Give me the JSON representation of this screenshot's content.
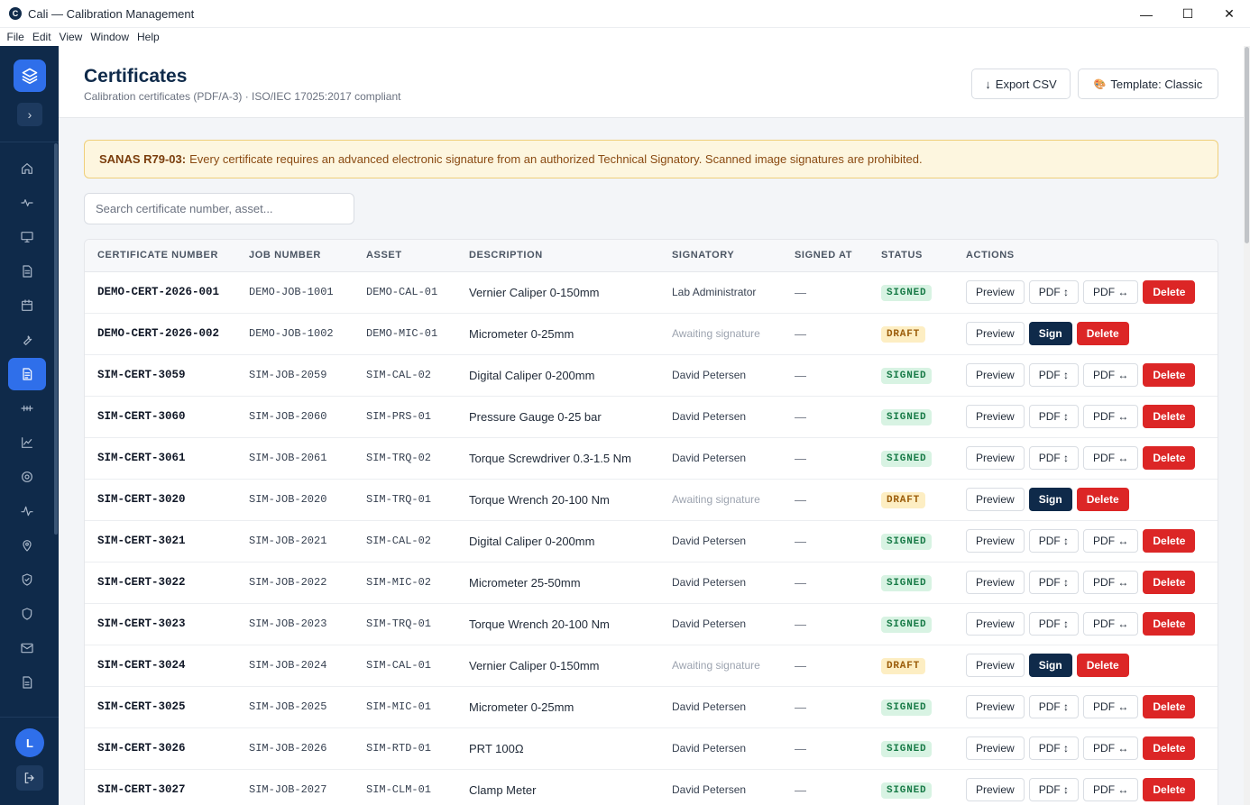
{
  "window": {
    "app_icon_letter": "C",
    "title": "Cali — Calibration Management",
    "controls": {
      "minimize": "—",
      "maximize": "☐",
      "close": "✕"
    }
  },
  "menu": [
    "File",
    "Edit",
    "View",
    "Window",
    "Help"
  ],
  "sidebar": {
    "collapse_glyph": "›",
    "nav": [
      {
        "icon": "home-icon",
        "active": false
      },
      {
        "icon": "activity-icon",
        "active": false
      },
      {
        "icon": "monitor-icon",
        "active": false
      },
      {
        "icon": "document-icon",
        "active": false
      },
      {
        "icon": "calendar-icon",
        "active": false
      },
      {
        "icon": "wrench-icon",
        "active": false
      },
      {
        "icon": "certificate-icon",
        "active": true
      },
      {
        "icon": "sliders-icon",
        "active": false
      },
      {
        "icon": "line-chart-icon",
        "active": false
      },
      {
        "icon": "target-icon",
        "active": false
      },
      {
        "icon": "pulse-icon",
        "active": false
      },
      {
        "icon": "map-pin-icon",
        "active": false
      },
      {
        "icon": "shield-check-icon",
        "active": false
      },
      {
        "icon": "shield-icon",
        "active": false
      },
      {
        "icon": "mail-icon",
        "active": false
      },
      {
        "icon": "file-list-icon",
        "active": false
      }
    ],
    "avatar_letter": "L"
  },
  "header": {
    "title": "Certificates",
    "subtitle": "Calibration certificates (PDF/A-3) · ISO/IEC 17025:2017 compliant",
    "export_label": "Export CSV",
    "export_glyph": "↓",
    "template_label": "Template: Classic",
    "template_glyph": "🎨"
  },
  "notice": {
    "code": "SANAS R79-03:",
    "text": "Every certificate requires an advanced electronic signature from an authorized Technical Signatory. Scanned image signatures are prohibited."
  },
  "search": {
    "placeholder": "Search certificate number, asset...",
    "value": ""
  },
  "table": {
    "columns": [
      "CERTIFICATE NUMBER",
      "JOB NUMBER",
      "ASSET",
      "DESCRIPTION",
      "SIGNATORY",
      "SIGNED AT",
      "STATUS",
      "ACTIONS"
    ],
    "action_labels": {
      "preview": "Preview",
      "pdf_portrait": "PDF ↕",
      "pdf_landscape": "PDF ↔",
      "sign": "Sign",
      "delete": "Delete"
    },
    "rows": [
      {
        "cert": "DEMO-CERT-2026-001",
        "job": "DEMO-JOB-1001",
        "asset": "DEMO-CAL-01",
        "desc": "Vernier Caliper 0-150mm",
        "signatory": "Lab Administrator",
        "signed_at": "—",
        "status": "SIGNED"
      },
      {
        "cert": "DEMO-CERT-2026-002",
        "job": "DEMO-JOB-1002",
        "asset": "DEMO-MIC-01",
        "desc": "Micrometer 0-25mm",
        "signatory": "Awaiting signature",
        "signed_at": "—",
        "status": "DRAFT"
      },
      {
        "cert": "SIM-CERT-3059",
        "job": "SIM-JOB-2059",
        "asset": "SIM-CAL-02",
        "desc": "Digital Caliper 0-200mm",
        "signatory": "David Petersen",
        "signed_at": "—",
        "status": "SIGNED"
      },
      {
        "cert": "SIM-CERT-3060",
        "job": "SIM-JOB-2060",
        "asset": "SIM-PRS-01",
        "desc": "Pressure Gauge 0-25 bar",
        "signatory": "David Petersen",
        "signed_at": "—",
        "status": "SIGNED"
      },
      {
        "cert": "SIM-CERT-3061",
        "job": "SIM-JOB-2061",
        "asset": "SIM-TRQ-02",
        "desc": "Torque Screwdriver 0.3-1.5 Nm",
        "signatory": "David Petersen",
        "signed_at": "—",
        "status": "SIGNED"
      },
      {
        "cert": "SIM-CERT-3020",
        "job": "SIM-JOB-2020",
        "asset": "SIM-TRQ-01",
        "desc": "Torque Wrench 20-100 Nm",
        "signatory": "Awaiting signature",
        "signed_at": "—",
        "status": "DRAFT"
      },
      {
        "cert": "SIM-CERT-3021",
        "job": "SIM-JOB-2021",
        "asset": "SIM-CAL-02",
        "desc": "Digital Caliper 0-200mm",
        "signatory": "David Petersen",
        "signed_at": "—",
        "status": "SIGNED"
      },
      {
        "cert": "SIM-CERT-3022",
        "job": "SIM-JOB-2022",
        "asset": "SIM-MIC-02",
        "desc": "Micrometer 25-50mm",
        "signatory": "David Petersen",
        "signed_at": "—",
        "status": "SIGNED"
      },
      {
        "cert": "SIM-CERT-3023",
        "job": "SIM-JOB-2023",
        "asset": "SIM-TRQ-01",
        "desc": "Torque Wrench 20-100 Nm",
        "signatory": "David Petersen",
        "signed_at": "—",
        "status": "SIGNED"
      },
      {
        "cert": "SIM-CERT-3024",
        "job": "SIM-JOB-2024",
        "asset": "SIM-CAL-01",
        "desc": "Vernier Caliper 0-150mm",
        "signatory": "Awaiting signature",
        "signed_at": "—",
        "status": "DRAFT"
      },
      {
        "cert": "SIM-CERT-3025",
        "job": "SIM-JOB-2025",
        "asset": "SIM-MIC-01",
        "desc": "Micrometer 0-25mm",
        "signatory": "David Petersen",
        "signed_at": "—",
        "status": "SIGNED"
      },
      {
        "cert": "SIM-CERT-3026",
        "job": "SIM-JOB-2026",
        "asset": "SIM-RTD-01",
        "desc": "PRT 100Ω",
        "signatory": "David Petersen",
        "signed_at": "—",
        "status": "SIGNED"
      },
      {
        "cert": "SIM-CERT-3027",
        "job": "SIM-JOB-2027",
        "asset": "SIM-CLM-01",
        "desc": "Clamp Meter",
        "signatory": "David Petersen",
        "signed_at": "—",
        "status": "SIGNED"
      }
    ]
  },
  "colors": {
    "sidebar_bg": "#0f2a4a",
    "accent": "#2f6fea",
    "signed_badge": "#d8f3e3",
    "draft_badge": "#fdeec3",
    "delete": "#dc2626",
    "notice_bg": "#fdf6df"
  }
}
